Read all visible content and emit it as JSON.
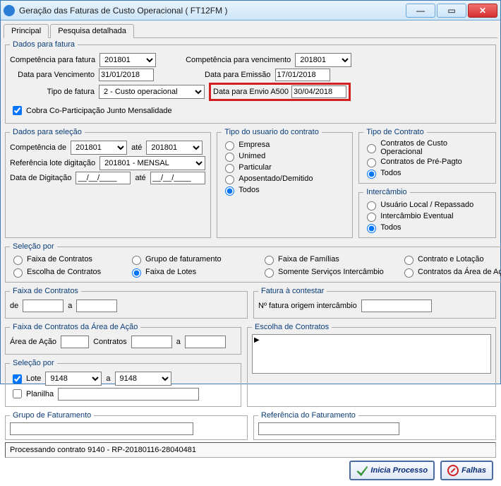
{
  "window": {
    "title": "Geração das Faturas de Custo Operacional         ( FT12FM )"
  },
  "tabs": {
    "t1": "Principal",
    "t2": "Pesquisa detalhada"
  },
  "dadosFatura": {
    "legend": "Dados para fatura",
    "compFaturaLabel": "Competência para fatura",
    "compFatura": "201801",
    "compVencLabel": "Competência para vencimento",
    "compVenc": "201801",
    "dataVencLabel": "Data para Vencimento",
    "dataVenc": "31/01/2018",
    "dataEmissaoLabel": "Data para Emissão",
    "dataEmissao": "17/01/2018",
    "tipoFaturaLabel": "Tipo de fatura",
    "tipoFatura": "2  - Custo operacional",
    "dataA500Label": "Data para Envio A500",
    "dataA500": "30/04/2018",
    "cobraCopart": "Cobra Co-Participação Junto Mensalidade"
  },
  "dadosSelecao": {
    "legend": "Dados para seleção",
    "compDeLabel": "Competência de",
    "compDe": "201801",
    "ateLabel": "até",
    "compAte": "201801",
    "refLoteLabel": "Referência lote digitação",
    "refLote": "201801 - MENSAL",
    "dataDigitLabel": "Data de Digitação",
    "dataDigitDe": "__/__/____",
    "dataDigitAte": "__/__/____"
  },
  "tipoUsuario": {
    "legend": "Tipo do usuario do contrato",
    "o1": "Empresa",
    "o2": "Unimed",
    "o3": "Particular",
    "o4": "Aposentado/Demitido",
    "o5": "Todos"
  },
  "tipoContrato": {
    "legend": "Tipo de Contrato",
    "o1": "Contratos de Custo Operacional",
    "o2": "Contratos de Pré-Pagto",
    "o3": "Todos"
  },
  "intercambio": {
    "legend": "Intercâmbio",
    "o1": "Usuário Local / Repassado",
    "o2": "Intercâmbio Eventual",
    "o3": "Todos"
  },
  "selecaoPor": {
    "legend": "Seleção por",
    "a1": "Faixa de Contratos",
    "a2": "Escolha de Contratos",
    "b1": "Grupo de faturamento",
    "b2": "Faixa de Lotes",
    "c1": "Faixa de Famílias",
    "c2": "Somente Serviços Intercâmbio",
    "d1": "Contrato e Lotação",
    "d2": "Contratos da Área de Ação"
  },
  "faixaContratos": {
    "legend": "Faixa de Contratos",
    "deLabel": "de",
    "aLabel": "a"
  },
  "faturaContestar": {
    "legend": "Fatura à contestar",
    "label": "Nº fatura origem intercâmbio"
  },
  "faixaArea": {
    "legend": "Faixa de Contratos da Área de Ação",
    "areaLabel": "Área de Ação",
    "contratosLabel": "Contratos",
    "aLabel": "a"
  },
  "escolhaContratos": {
    "legend": "Escolha de Contratos"
  },
  "selecaoPor2": {
    "legend": "Seleção por",
    "loteLabel": "Lote",
    "loteDe": "9148",
    "aLabel": "a",
    "loteAte": "9148",
    "planilhaLabel": "Planilha"
  },
  "grupoFaturamento": {
    "legend": "Grupo de Faturamento"
  },
  "refFaturamento": {
    "legend": "Referência do Faturamento"
  },
  "status": "Processando contrato 9140 - RP-20180116-28040481",
  "buttons": {
    "inicia": "Inicia Processo",
    "falhas": "Falhas"
  }
}
